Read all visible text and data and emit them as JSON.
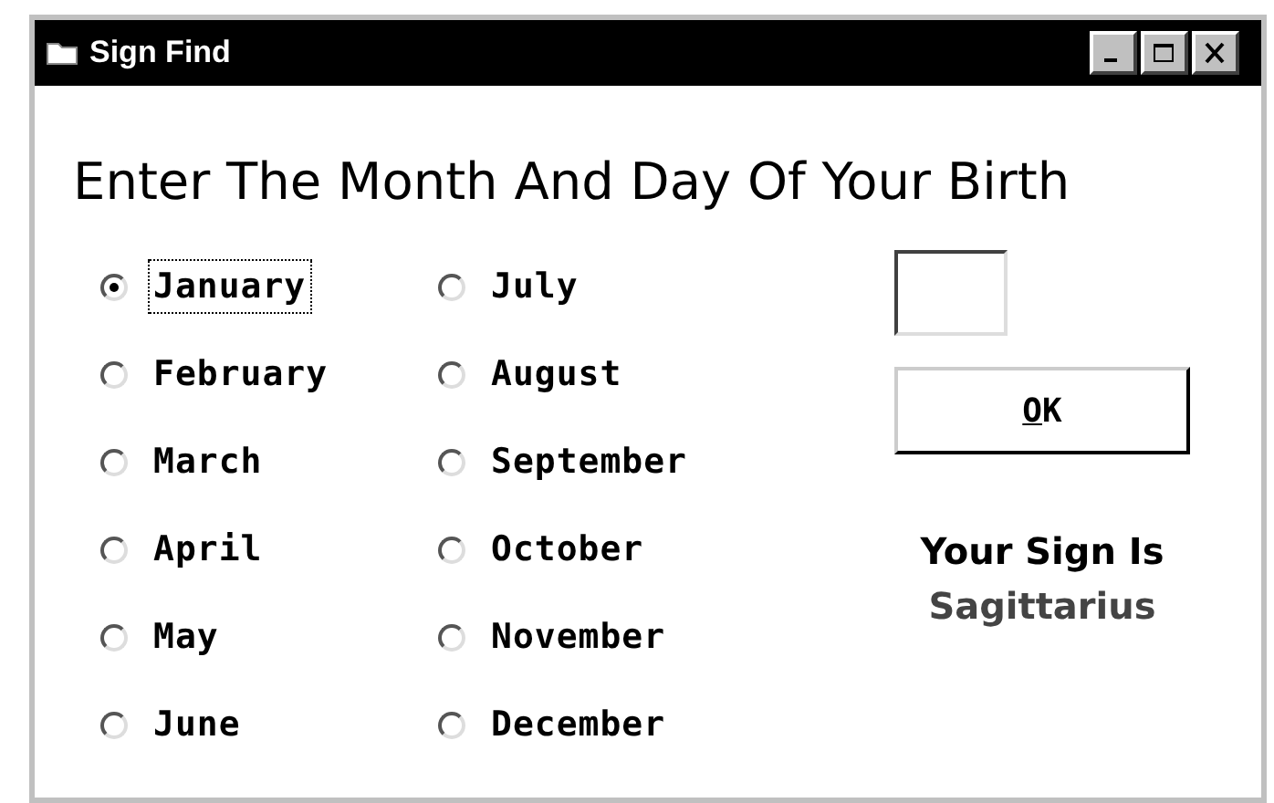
{
  "window": {
    "title": "Sign Find"
  },
  "heading": "Enter The Month And Day Of Your Birth",
  "months": [
    {
      "label": "January",
      "selected": true
    },
    {
      "label": "February",
      "selected": false
    },
    {
      "label": "March",
      "selected": false
    },
    {
      "label": "April",
      "selected": false
    },
    {
      "label": "May",
      "selected": false
    },
    {
      "label": "June",
      "selected": false
    },
    {
      "label": "July",
      "selected": false
    },
    {
      "label": "August",
      "selected": false
    },
    {
      "label": "September",
      "selected": false
    },
    {
      "label": "October",
      "selected": false
    },
    {
      "label": "November",
      "selected": false
    },
    {
      "label": "December",
      "selected": false
    }
  ],
  "ok_button": {
    "label": "OK"
  },
  "result_label": "Your Sign Is",
  "result_value": "Sagittarius"
}
